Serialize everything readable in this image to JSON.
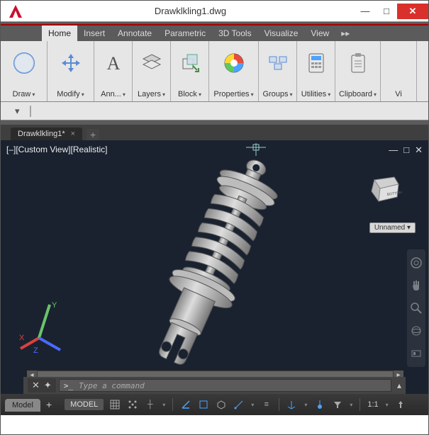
{
  "window": {
    "title": "Drawklkling1.dwg"
  },
  "menu": {
    "items": [
      "Home",
      "Insert",
      "Annotate",
      "Parametric",
      "3D Tools",
      "Visualize",
      "View"
    ],
    "active": "Home"
  },
  "ribbon": {
    "panels": [
      {
        "label": "Draw",
        "icon": "circle"
      },
      {
        "label": "Modify",
        "icon": "move"
      },
      {
        "label": "Ann...",
        "icon": "text"
      },
      {
        "label": "Layers",
        "icon": "layers"
      },
      {
        "label": "Block",
        "icon": "block"
      },
      {
        "label": "Properties",
        "icon": "palette"
      },
      {
        "label": "Groups",
        "icon": "groups"
      },
      {
        "label": "Utilities",
        "icon": "calc"
      },
      {
        "label": "Clipboard",
        "icon": "clipboard"
      },
      {
        "label": "Vi",
        "icon": "none"
      }
    ]
  },
  "doc_tab": {
    "label": "Drawklkling1*",
    "close": "×"
  },
  "viewport": {
    "label": "[–][Custom View][Realistic]",
    "unnamed": "Unnamed",
    "cube_face": "BOTTOM",
    "axes": {
      "x": "X",
      "y": "Y",
      "z": "Z"
    }
  },
  "command": {
    "placeholder": "Type a command",
    "prompt": ">_"
  },
  "status": {
    "model_tab": "Model",
    "model_btn": "MODEL",
    "zoom": "1:1"
  }
}
